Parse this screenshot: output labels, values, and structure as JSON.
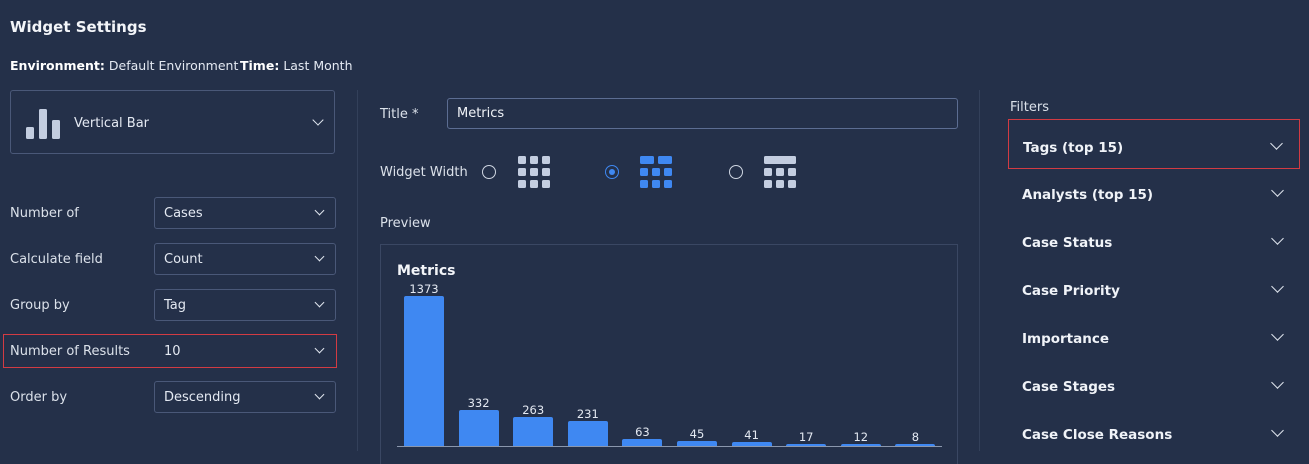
{
  "header": {
    "title": "Widget Settings",
    "environment_label": "Environment:",
    "environment_value": "Default Environment",
    "time_label": "Time:",
    "time_value": "Last Month"
  },
  "chart_type": {
    "icon": "vertical-bar-chart-icon",
    "label": "Vertical Bar"
  },
  "settings": [
    {
      "label": "Number of",
      "value": "Cases"
    },
    {
      "label": "Calculate field",
      "value": "Count"
    },
    {
      "label": "Group by",
      "value": "Tag"
    },
    {
      "label": "Number of Results",
      "value": "10",
      "highlighted": true
    },
    {
      "label": "Order by",
      "value": "Descending"
    }
  ],
  "title_field": {
    "label": "Title *",
    "value": "Metrics"
  },
  "widget_width": {
    "label": "Widget Width",
    "options": [
      {
        "icon": "grid-small-icon",
        "selected": false
      },
      {
        "icon": "grid-medium-icon",
        "selected": true
      },
      {
        "icon": "grid-large-icon",
        "selected": false
      }
    ]
  },
  "preview": {
    "label": "Preview"
  },
  "chart_data": {
    "type": "bar",
    "title": "Metrics",
    "categories": [],
    "values": [
      1373,
      332,
      263,
      231,
      63,
      45,
      41,
      17,
      12,
      8
    ],
    "ylim": [
      0,
      1373
    ],
    "grid": false,
    "legend": "none",
    "color": "#3f88f2"
  },
  "filters": {
    "label": "Filters",
    "items": [
      {
        "label": "Tags (top 15)",
        "highlighted": true
      },
      {
        "label": "Analysts (top 15)"
      },
      {
        "label": "Case Status"
      },
      {
        "label": "Case Priority"
      },
      {
        "label": "Importance"
      },
      {
        "label": "Case Stages"
      },
      {
        "label": "Case Close Reasons"
      }
    ]
  },
  "colors": {
    "background": "#243049",
    "accent": "#3f88f2",
    "highlight": "#d23b43",
    "border": "#4a5878"
  }
}
